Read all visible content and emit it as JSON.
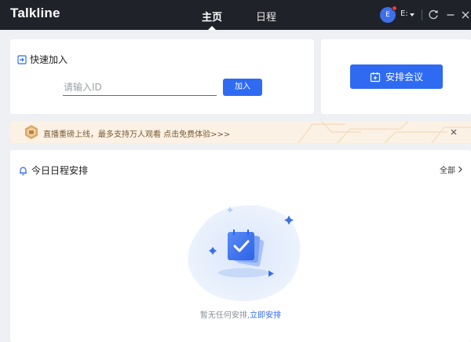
{
  "app": {
    "logo": "Talkline"
  },
  "nav": {
    "tabs": [
      {
        "label": "主页",
        "active": true
      },
      {
        "label": "日程",
        "active": false
      }
    ]
  },
  "user": {
    "avatar_initial": "E",
    "name": "E:",
    "has_notification": true
  },
  "window_controls": {
    "icons": [
      "refresh-icon",
      "minimize-icon",
      "close-icon"
    ]
  },
  "quick_join": {
    "title": "快速加入",
    "input_placeholder": "请输入ID",
    "input_value": "",
    "join_label": "加入"
  },
  "meeting": {
    "schedule_label": "安排会议"
  },
  "banner": {
    "text": "直播重磅上线，最多支持万人观看 点击免费体验>>>"
  },
  "schedule": {
    "title": "今日日程安排",
    "all_label": "全部",
    "empty_text": "暂无任何安排,",
    "empty_link": "立即安排"
  },
  "colors": {
    "titlebar_bg": "#1f2229",
    "accent": "#2f6bf2",
    "banner_bg": "#fbf1e4",
    "banner_text": "#7a5a35",
    "page_bg": "#eef0f4",
    "notification": "#ef3b3b"
  }
}
